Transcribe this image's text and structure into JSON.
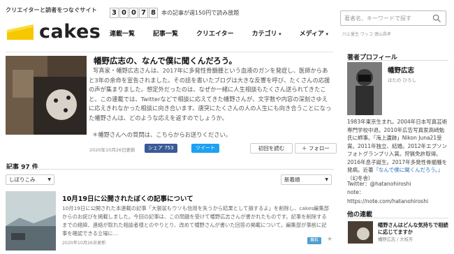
{
  "header": {
    "tagline": "クリエイターと読者をつなぐサイト",
    "logo_text": "cakes",
    "counter_digits": [
      "3",
      "0",
      "0",
      "7",
      "8"
    ],
    "counter_text": "本の記事が週150円で読み放題",
    "nav": [
      {
        "label": "連載一覧",
        "dropdown": false
      },
      {
        "label": "記事一覧",
        "dropdown": false
      },
      {
        "label": "クリエイター",
        "dropdown": false
      },
      {
        "label": "カテゴリ",
        "dropdown": true
      },
      {
        "label": "メディア",
        "dropdown": true
      }
    ],
    "search_placeholder": "著者名、キーワードで探す",
    "search_sub": "川上量生 ワッコ 徳山昌孝",
    "accent_color": "#f5c800"
  },
  "feature": {
    "title": "幡野広志の、なんで僕に聞くんだろう。",
    "body": "写真家・幡野広志さんは、2017年に多発性骨髄腫という血液のガンを発症し、医師からあと3年の余命を宣告されました。その話を書いたブログは大きな反響を呼び、たくさんの応援の声が集まりました。想定外だったのは、なぜか一緒に人生相談もたくさん送られてきたこと。この連載では、Twitterなどで相談に応えてきた幡野さんが、文字数や内容の深刻さゆえに応えきれなかった相談に向き合います。唐突にたくさんの人の人生にも向き合うことになった幡野さんは、どのような応えを返すのでしょうか。",
    "note": "＊幡野さんへの質問は、こちらからお送りください。",
    "date": "2020年10月26日更新",
    "share_fb": "シェア 753",
    "share_tw": "ツイート",
    "read_first": "初回を読む",
    "follow": "＋ フォロー"
  },
  "list": {
    "count_label": "記事 97 件",
    "filter_label": "しぼりこみ",
    "sort_label": "新着順"
  },
  "article": {
    "title": "10月19日に公開されたぼくの記事について",
    "body": "10月19日に公開された本連載の記事「大袈裟もウソも信用を失うから結果として損するよ」を削除し、cakes編集部からのお詫びを掲載しました。今回の記事は、この問題を受けて幡野広志さんが書かれたものです。記事を削除するまでの経緯、連絡が取れた相談者様とのやりとり、改めて幡野さんが書いた回答の掲載について。編集部が事前に記事を確認できる立場に…",
    "date": "2020年10月26日更新",
    "badge": "無料",
    "star_icon": "star-icon"
  },
  "profile": {
    "heading": "著者プロフィール",
    "name": "幡野広志",
    "kana": "はたの ひろし",
    "bio": "1983年東京生まれ。2004年日本写真芸術専門学校中退。2010年広告写真家高崎勉氏に師事。「海上遺跡」Nikon Juna21受賞。2011年独立、結婚。2012年エプソンフォトグランプリ入賞。狩猟免許取得。2016年息子誕生。2017年多発性骨髄腫を発病。近著",
    "bio_link": "『なんで僕に聞くんだろう。』",
    "bio_end": "（幻冬舎）",
    "twitter": "Twitter：@hatanohiroshi",
    "note_label": "note：",
    "note_url": "https://note.com/hatanohiroshi"
  },
  "other": {
    "heading": "他の連載",
    "title": "幡野さんはどんな気持ちで相続に応じてますか",
    "author": "幡野広志 / 大枝芳"
  }
}
